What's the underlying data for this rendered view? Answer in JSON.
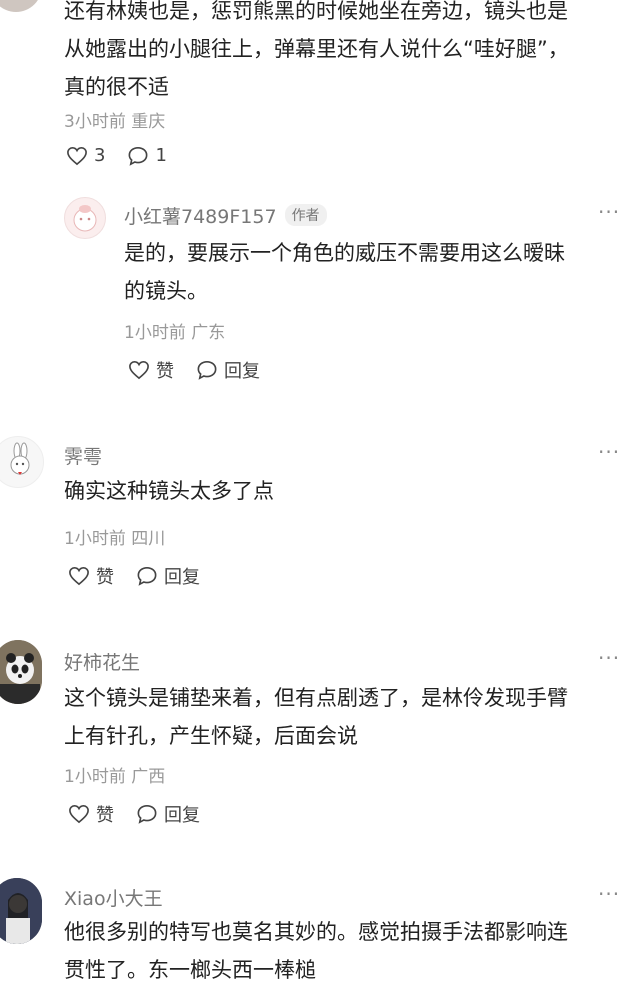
{
  "comments": [
    {
      "text_lines": [
        "还有林姨也是，惩罚熊黑的时候她坐在旁边，镜头也是",
        "从她露出的小腿往上，弹幕里还有人说什么“哇好腿”，",
        "真的很不适"
      ],
      "meta": "3小时前 重庆",
      "likes": "3",
      "replies": "1"
    },
    {
      "name": "小红薯7489F157",
      "author_tag": "作者",
      "text_lines": [
        "是的，要展示一个角色的威压不需要用这么暧昧",
        "的镜头。"
      ],
      "meta": "1小时前 广东",
      "like_label": "赞",
      "reply_label": "回复"
    },
    {
      "name": "霁雩",
      "text_lines": [
        "确实这种镜头太多了点"
      ],
      "meta": "1小时前 四川",
      "like_label": "赞",
      "reply_label": "回复"
    },
    {
      "name": "好柿花生",
      "text_lines": [
        "这个镜头是铺垫来着，但有点剧透了，是林伶发现手臂",
        "上有针孔，产生怀疑，后面会说"
      ],
      "meta": "1小时前 广西",
      "like_label": "赞",
      "reply_label": "回复"
    },
    {
      "name": "Xiao小大王",
      "text_lines": [
        "他很多别的特写也莫名其妙的。感觉拍摄手法都影响连",
        "贯性了。东一榔头西一棒槌"
      ]
    }
  ],
  "more_glyph": "···",
  "icons": {
    "like": "heart-outline-icon",
    "reply": "speech-bubble-icon",
    "more": "more-dots-icon"
  },
  "colors": {
    "text": "#222222",
    "meta": "#999999",
    "name": "#777777"
  }
}
